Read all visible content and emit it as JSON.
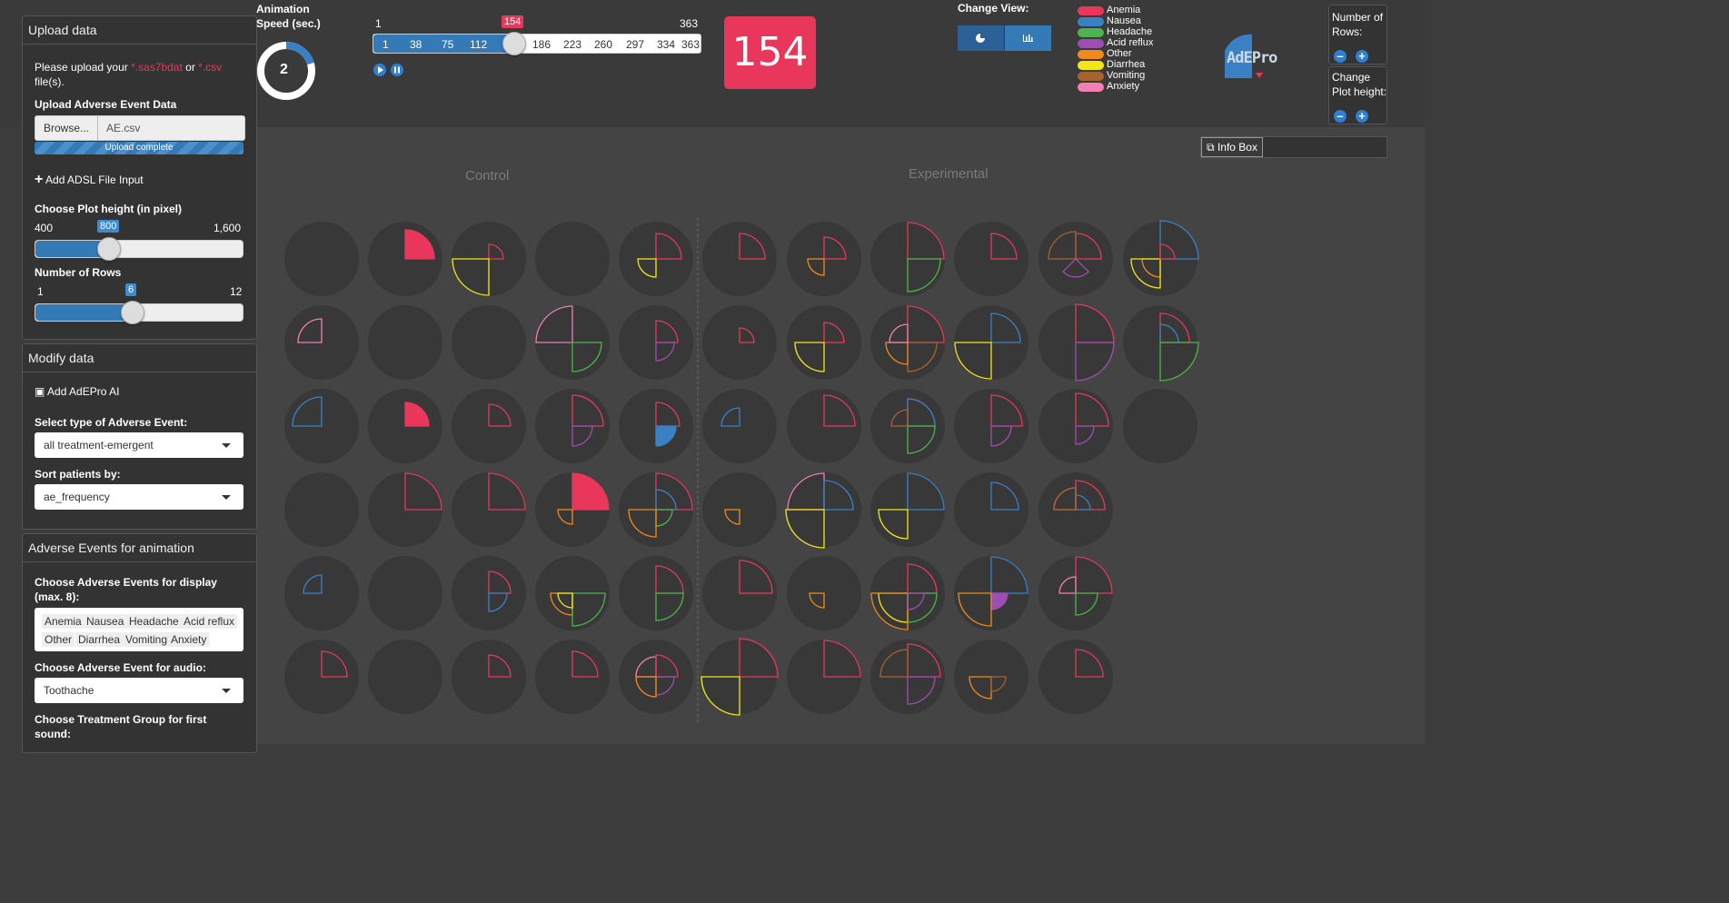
{
  "sidebar": {
    "upload": {
      "title": "Upload data",
      "prompt_prefix": "Please upload your",
      "ext1": "*.sas7bdat",
      "or": "or",
      "ext2": "*.csv",
      "prompt_suffix": "file(s).",
      "ae_label": "Upload Adverse Event Data",
      "browse": "Browse...",
      "file_name": "AE.csv",
      "progress": "Upload complete",
      "progress_fraction": 1.0,
      "add_adsl": "Add ADSL File Input",
      "plot_height_label": "Choose Plot height (in pixel)",
      "plot_height_min": "400",
      "plot_height_value": "800",
      "plot_height_max": "1,600",
      "rows_label": "Number of Rows",
      "rows_min": "1",
      "rows_value": "6",
      "rows_max": "12"
    },
    "modify": {
      "title": "Modify data",
      "add_ai": "Add AdEPro AI",
      "ae_type_label": "Select type of Adverse Event:",
      "ae_type_value": "all treatment-emergent",
      "sort_label": "Sort patients by:",
      "sort_value": "ae_frequency"
    },
    "animation": {
      "title": "Adverse Events for animation",
      "display_label": "Choose Adverse Events for display (max. 8):",
      "display_tags": [
        "Anemia",
        "Nausea",
        "Headache",
        "Acid reflux",
        "Other",
        "Diarrhea",
        "Vomiting",
        "Anxiety"
      ],
      "audio_label": "Choose Adverse Event for audio:",
      "audio_value": "Toothache",
      "treat_label": "Choose Treatment Group for first sound:"
    }
  },
  "top": {
    "anim_speed_label_1": "Animation",
    "anim_speed_label_2": "Speed (sec.)",
    "anim_speed_value": "2",
    "slider_min": "1",
    "slider_max": "363",
    "slider_current": "154",
    "slider_ticks": [
      "1",
      "38",
      "75",
      "112",
      "186",
      "223",
      "260",
      "297",
      "334",
      "363"
    ],
    "day_display": "154",
    "change_view": "Change View:",
    "rows_label": "Number of Rows:",
    "height_label": "Change Plot height:",
    "logo_text": "AdEPro",
    "info_box": "Info Box"
  },
  "legend": [
    {
      "name": "Anemia",
      "color": "#e8375b"
    },
    {
      "name": "Nausea",
      "color": "#3a80c4"
    },
    {
      "name": "Headache",
      "color": "#4db34d"
    },
    {
      "name": "Acid reflux",
      "color": "#9b4fb0"
    },
    {
      "name": "Other",
      "color": "#f08a1c"
    },
    {
      "name": "Diarrhea",
      "color": "#f2e61a"
    },
    {
      "name": "Vomiting",
      "color": "#a8622e"
    },
    {
      "name": "Anxiety",
      "color": "#f07fb4"
    }
  ],
  "groups": {
    "control": "Control",
    "experimental": "Experimental"
  }
}
